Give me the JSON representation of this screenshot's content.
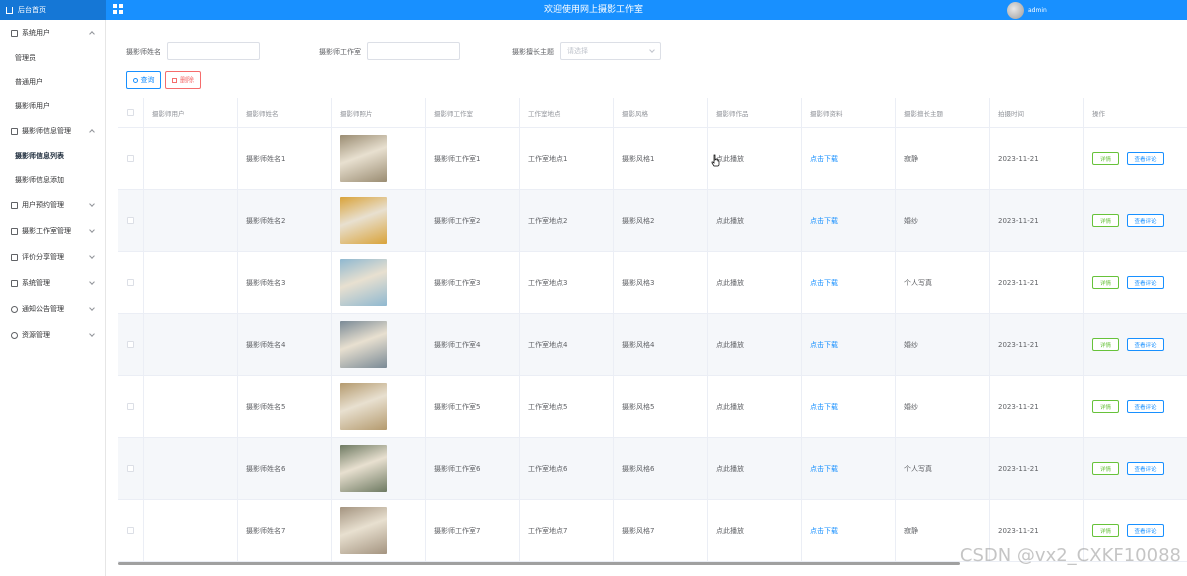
{
  "header": {
    "brand": "后台首页",
    "title": "欢迎使用网上摄影工作室",
    "username": "admin"
  },
  "sidebar": {
    "groups": [
      {
        "label": "系统用户",
        "icon": "user-icon",
        "expanded": true,
        "items": [
          "管理员",
          "普通用户",
          "摄影师用户"
        ]
      },
      {
        "label": "摄影师信息管理",
        "icon": "edit-icon",
        "expanded": true,
        "items": [
          "摄影师信息列表",
          "摄影师信息添加"
        ]
      },
      {
        "label": "用户预约管理",
        "icon": "edit-icon",
        "expanded": false,
        "items": []
      },
      {
        "label": "摄影工作室管理",
        "icon": "edit-icon",
        "expanded": false,
        "items": []
      },
      {
        "label": "评价分享管理",
        "icon": "edit-icon",
        "expanded": false,
        "items": []
      },
      {
        "label": "系统管理",
        "icon": "settings-icon",
        "expanded": false,
        "items": []
      },
      {
        "label": "通知公告管理",
        "icon": "info-icon",
        "expanded": false,
        "items": []
      },
      {
        "label": "资源管理",
        "icon": "resource-icon",
        "expanded": false,
        "items": []
      }
    ],
    "active_item": "摄影师信息列表"
  },
  "search": {
    "name_label": "摄影师姓名",
    "name_value": "",
    "studio_label": "摄影师工作室",
    "studio_value": "",
    "theme_label": "摄影擅长主题",
    "theme_placeholder": "请选择"
  },
  "actions": {
    "query": "查询",
    "delete": "删除"
  },
  "table": {
    "columns": [
      "摄影师用户",
      "摄影师姓名",
      "摄影师照片",
      "摄影师工作室",
      "工作室地点",
      "摄影风格",
      "摄影师作品",
      "摄影师资料",
      "摄影擅长主题",
      "拍摄时间",
      "操作"
    ],
    "op_detail": "详情",
    "op_review": "查看评论",
    "rows": [
      {
        "user": "",
        "name": "摄影师姓名1",
        "studio": "摄影师工作室1",
        "location": "工作室地点1",
        "style": "摄影风格1",
        "works": "点此播放",
        "profile": "点击下载",
        "theme": "寂静",
        "date": "2023-11-21",
        "photo_color": "#9a8c72"
      },
      {
        "user": "",
        "name": "摄影师姓名2",
        "studio": "摄影师工作室2",
        "location": "工作室地点2",
        "style": "摄影风格2",
        "works": "点此播放",
        "profile": "点击下载",
        "theme": "婚纱",
        "date": "2023-11-21",
        "photo_color": "#d9a33a"
      },
      {
        "user": "",
        "name": "摄影师姓名3",
        "studio": "摄影师工作室3",
        "location": "工作室地点3",
        "style": "摄影风格3",
        "works": "点此播放",
        "profile": "点击下载",
        "theme": "个人写真",
        "date": "2023-11-21",
        "photo_color": "#8fb8d0"
      },
      {
        "user": "",
        "name": "摄影师姓名4",
        "studio": "摄影师工作室4",
        "location": "工作室地点4",
        "style": "摄影风格4",
        "works": "点此播放",
        "profile": "点击下载",
        "theme": "婚纱",
        "date": "2023-11-21",
        "photo_color": "#7a8a96"
      },
      {
        "user": "",
        "name": "摄影师姓名5",
        "studio": "摄影师工作室5",
        "location": "工作室地点5",
        "style": "摄影风格5",
        "works": "点此播放",
        "profile": "点击下载",
        "theme": "婚纱",
        "date": "2023-11-21",
        "photo_color": "#b49a6e"
      },
      {
        "user": "",
        "name": "摄影师姓名6",
        "studio": "摄影师工作室6",
        "location": "工作室地点6",
        "style": "摄影风格6",
        "works": "点此播放",
        "profile": "点击下载",
        "theme": "个人写真",
        "date": "2023-11-21",
        "photo_color": "#6e7a62"
      },
      {
        "user": "",
        "name": "摄影师姓名7",
        "studio": "摄影师工作室7",
        "location": "工作室地点7",
        "style": "摄影风格7",
        "works": "点此播放",
        "profile": "点击下载",
        "theme": "寂静",
        "date": "2023-11-21",
        "photo_color": "#a49480"
      }
    ]
  },
  "watermark": "CSDN @vx2_CXKF10088",
  "colors": {
    "primary": "#1890ff",
    "danger": "#f56c6c",
    "success": "#67c23a"
  }
}
